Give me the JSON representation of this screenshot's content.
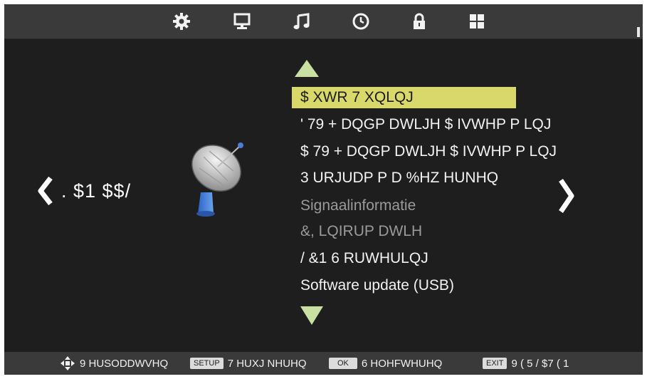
{
  "top_tabs": [
    {
      "icon": "gear-icon"
    },
    {
      "icon": "monitor-icon"
    },
    {
      "icon": "music-note-icon"
    },
    {
      "icon": "clock-icon"
    },
    {
      "icon": "lock-icon"
    },
    {
      "icon": "grid-icon"
    }
  ],
  "category": {
    "name": ". $1 $$/",
    "icon": "satellite-dish-icon"
  },
  "menu": {
    "items": [
      {
        "label": "$ XWR 7 XQLQJ",
        "state": "selected"
      },
      {
        "label": "' 79 + DQGP DWLJH $ IVWHP P LQJ",
        "state": "enabled"
      },
      {
        "label": "$ 79 + DQGP DWLJH $ IVWHP P LQJ",
        "state": "enabled"
      },
      {
        "label": "3 URJUDP P D %HZ HUNHQ",
        "state": "enabled"
      },
      {
        "label": "Signaalinformatie",
        "state": "disabled"
      },
      {
        "label": "&, LQIRUP DWLH",
        "state": "disabled"
      },
      {
        "label": "/ &1 6 RUWHULQJ",
        "state": "enabled"
      },
      {
        "label": "Software update (USB)",
        "state": "enabled"
      }
    ]
  },
  "footer": {
    "navigate_icon": "four-way-arrow-icon",
    "navigate_label": "9 HUSODDWVHQ",
    "setup_key": "SETUP",
    "setup_label": "7 HUXJ NHUHQ",
    "ok_key": "OK",
    "ok_label": "6 HOHFWHUHQ",
    "exit_key": "EXIT",
    "exit_label": "9 ( 5 / $7 ( 1"
  },
  "colors": {
    "highlight": "#d9d86a",
    "arrow": "#c9e0a2",
    "background": "#1e1e1e",
    "bar": "#3a3a3a"
  }
}
